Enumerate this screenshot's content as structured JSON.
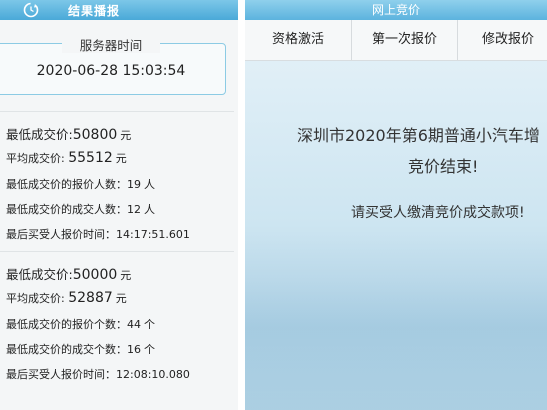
{
  "left": {
    "header_title": "结果播报",
    "server_time_label": "服务器时间",
    "server_time_value": "2020-06-28 15:03:54",
    "blocks": [
      {
        "min_price_label": "最低成交价:",
        "min_price_value": "50800",
        "min_price_unit": "元",
        "avg_price_label": "平均成交价:",
        "avg_price_value": "55512",
        "avg_price_unit": "元",
        "bidders_label": "最低成交价的报价人数：",
        "bidders_value": "19",
        "bidders_unit": "人",
        "deals_label": "最低成交价的成交人数：",
        "deals_value": "12",
        "deals_unit": "人",
        "last_time_label": "最后买受人报价时间：",
        "last_time_value": "14:17:51.601"
      },
      {
        "min_price_label": "最低成交价:",
        "min_price_value": "50000",
        "min_price_unit": "元",
        "avg_price_label": "平均成交价:",
        "avg_price_value": "52887",
        "avg_price_unit": "元",
        "bidders_label": "最低成交价的报价个数：",
        "bidders_value": "44",
        "bidders_unit": "个",
        "deals_label": "最低成交价的成交个数：",
        "deals_value": "16",
        "deals_unit": "个",
        "last_time_label": "最后买受人报价时间：",
        "last_time_value": "12:08:10.080"
      }
    ]
  },
  "right": {
    "header_title": "网上竞价",
    "tabs": [
      "资格激活",
      "第一次报价",
      "修改报价"
    ],
    "result_line1": "深圳市2020年第6期普通小汽车增",
    "result_line2": "竞价结束!",
    "result_line3": "请买受人缴清竞价成交款项!"
  },
  "colors": {
    "header_blue": "#5cb3de",
    "box_border": "#8ccbe4"
  }
}
